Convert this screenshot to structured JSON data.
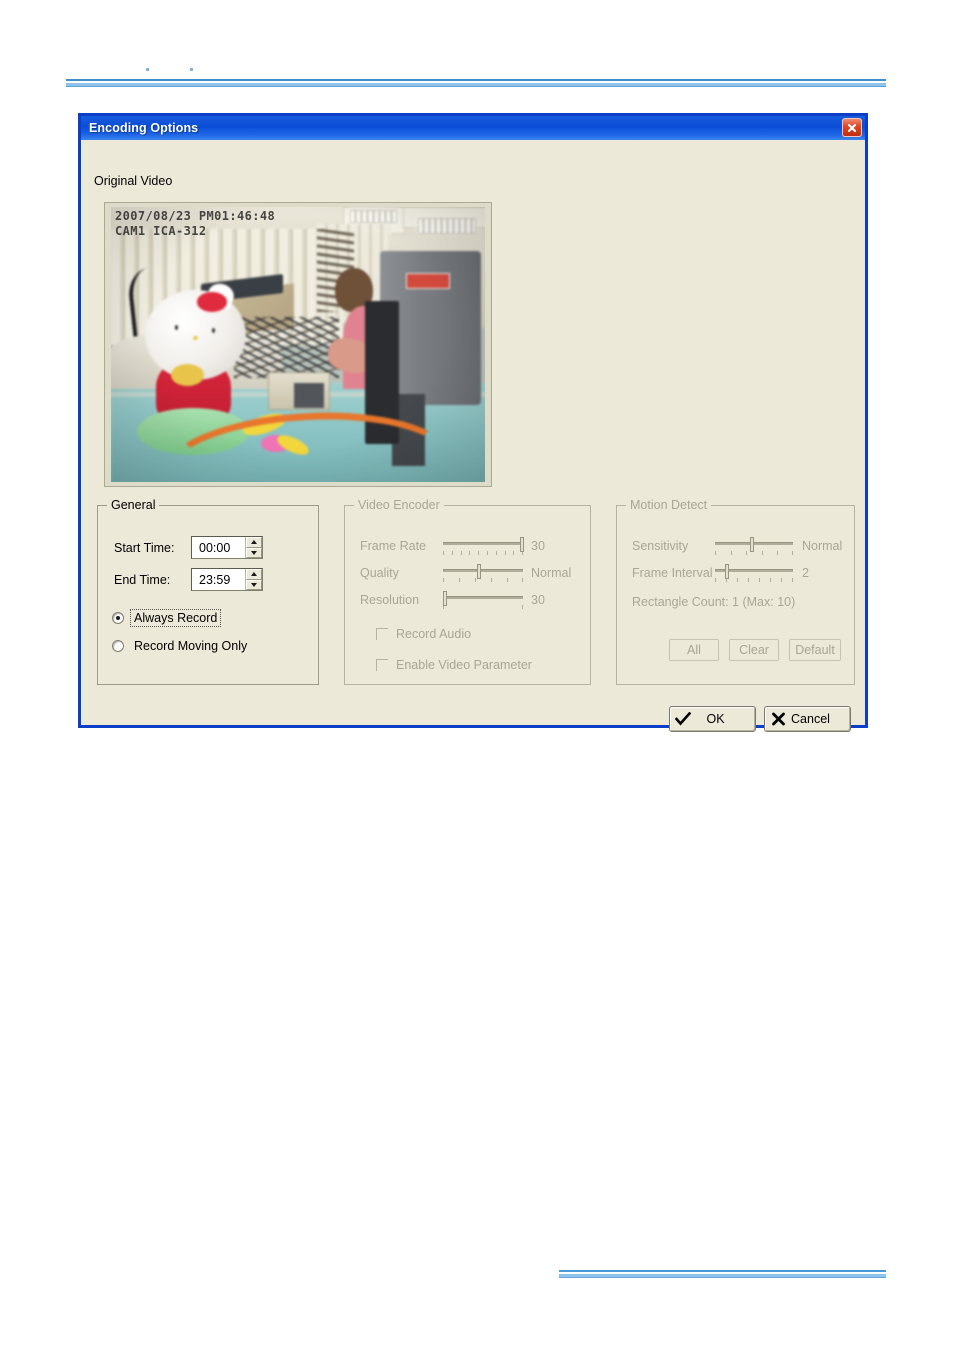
{
  "dialog": {
    "title": "Encoding Options",
    "close_icon": "close-icon",
    "preview_label": "Original Video",
    "video": {
      "osd_line1": "2007/08/23 PM01:46:48",
      "osd_line2": "CAM1 ICA-312"
    },
    "general": {
      "title": "General",
      "start_time_label": "Start Time:",
      "start_time_value": "00:00",
      "end_time_label": "End Time:",
      "end_time_value": "23:59",
      "radio_always": "Always Record",
      "radio_moving": "Record Moving Only",
      "selected": "Always Record"
    },
    "encoder": {
      "title": "Video Encoder",
      "frame_rate_label": "Frame Rate",
      "frame_rate_value": "30",
      "quality_label": "Quality",
      "quality_value": "Normal",
      "resolution_label": "Resolution",
      "resolution_value": "30",
      "record_audio_label": "Record Audio",
      "record_audio_checked": false,
      "enable_video_param_label": "Enable Video Parameter",
      "enable_video_param_checked": false,
      "enabled": false
    },
    "motion": {
      "title": "Motion Detect",
      "sensitivity_label": "Sensitivity",
      "sensitivity_value": "Normal",
      "frame_interval_label": "Frame Interval",
      "frame_interval_value": "2",
      "rectangle_count_label": "Rectangle Count: 1  (Max: 10)",
      "btn_all": "All",
      "btn_clear": "Clear",
      "btn_default": "Default",
      "enabled": false
    },
    "footer": {
      "ok_label": "OK",
      "ok_icon": "check-icon",
      "cancel_label": "Cancel",
      "cancel_icon": "x-icon"
    },
    "colors": {
      "titlebar_blue": "#0b4ed6",
      "dialog_border": "#0b3fc8",
      "dialog_face": "#ece9d8",
      "close_red": "#c02c10",
      "disabled_text": "#a9a694",
      "page_rule": "#4a98d8"
    }
  }
}
